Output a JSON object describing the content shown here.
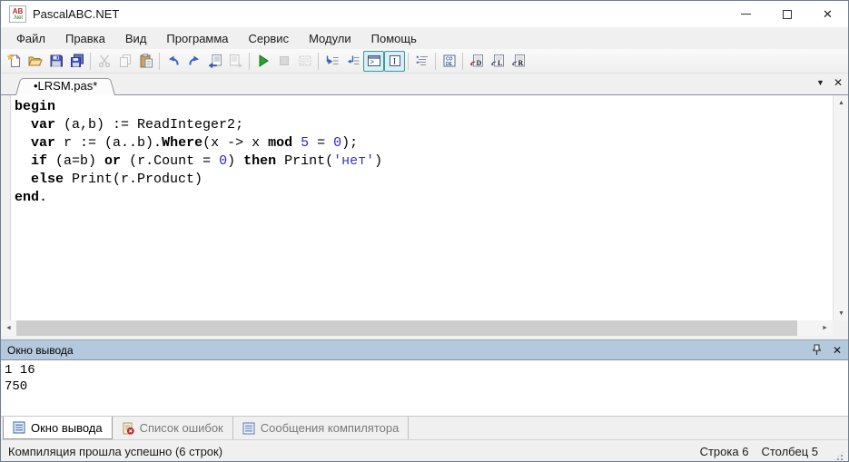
{
  "titlebar": {
    "title": "PascalABC.NET",
    "close_glyph": "✕",
    "icon_top": "AB",
    "icon_bottom": ".Net"
  },
  "menu": {
    "items": [
      {
        "label": "Файл"
      },
      {
        "label": "Правка"
      },
      {
        "label": "Вид"
      },
      {
        "label": "Программа"
      },
      {
        "label": "Сервис"
      },
      {
        "label": "Модули"
      },
      {
        "label": "Помощь"
      }
    ]
  },
  "toolbar": {
    "console_glyph": ">",
    "cursor_glyph": "I",
    "code_top": "CO",
    "code_bottom": "DE",
    "template_d": "D",
    "template_l": "L",
    "template_r": "R"
  },
  "tabbar": {
    "tab_label": "•LRSM.pas*",
    "overflow_glyph": "▼",
    "close_glyph": "✕"
  },
  "editor": {
    "lines": [
      {
        "tokens": [
          {
            "t": "begin",
            "c": "kw"
          }
        ]
      },
      {
        "tokens": [
          {
            "t": "  ",
            "c": "pl"
          },
          {
            "t": "var",
            "c": "kw"
          },
          {
            "t": " (a,b) := ReadInteger2;",
            "c": "pl"
          }
        ]
      },
      {
        "tokens": [
          {
            "t": "  ",
            "c": "pl"
          },
          {
            "t": "var",
            "c": "kw"
          },
          {
            "t": " r := (a..b).",
            "c": "pl"
          },
          {
            "t": "Where",
            "c": "kw"
          },
          {
            "t": "(x -> x ",
            "c": "pl"
          },
          {
            "t": "mod",
            "c": "kw"
          },
          {
            "t": " ",
            "c": "pl"
          },
          {
            "t": "5",
            "c": "num"
          },
          {
            "t": " = ",
            "c": "pl"
          },
          {
            "t": "0",
            "c": "num"
          },
          {
            "t": ");",
            "c": "pl"
          }
        ]
      },
      {
        "tokens": [
          {
            "t": "  ",
            "c": "pl"
          },
          {
            "t": "if",
            "c": "kw"
          },
          {
            "t": " (a=b) ",
            "c": "pl"
          },
          {
            "t": "or",
            "c": "kw"
          },
          {
            "t": " (r.Count = ",
            "c": "pl"
          },
          {
            "t": "0",
            "c": "num"
          },
          {
            "t": ") ",
            "c": "pl"
          },
          {
            "t": "then",
            "c": "kw"
          },
          {
            "t": " Print(",
            "c": "pl"
          },
          {
            "t": "'нет'",
            "c": "str"
          },
          {
            "t": ")",
            "c": "pl"
          }
        ]
      },
      {
        "tokens": [
          {
            "t": "  ",
            "c": "pl"
          },
          {
            "t": "else",
            "c": "kw"
          },
          {
            "t": " Print(r.Product)",
            "c": "pl"
          }
        ]
      },
      {
        "tokens": [
          {
            "t": "end",
            "c": "kw"
          },
          {
            "t": ".",
            "c": "pl"
          }
        ]
      }
    ]
  },
  "scroll": {
    "up": "▲",
    "down": "▼",
    "left": "◄",
    "right": "►"
  },
  "output": {
    "title": "Окно вывода",
    "lines": [
      "1 16",
      "750"
    ],
    "close_glyph": "✕"
  },
  "bottom_tabs": {
    "tabs": [
      {
        "label": "Окно вывода"
      },
      {
        "label": "Список ошибок"
      },
      {
        "label": "Сообщения компилятора"
      }
    ]
  },
  "statusbar": {
    "message": "Компиляция прошла успешно (6 строк)",
    "row": "Строка 6",
    "column": "Столбец 5"
  },
  "colors": {
    "accent_blue": "#2727cc",
    "toggle_teal": "#3a9b9b",
    "output_header": "#b4c9dd",
    "run_green": "#2ea02e"
  }
}
